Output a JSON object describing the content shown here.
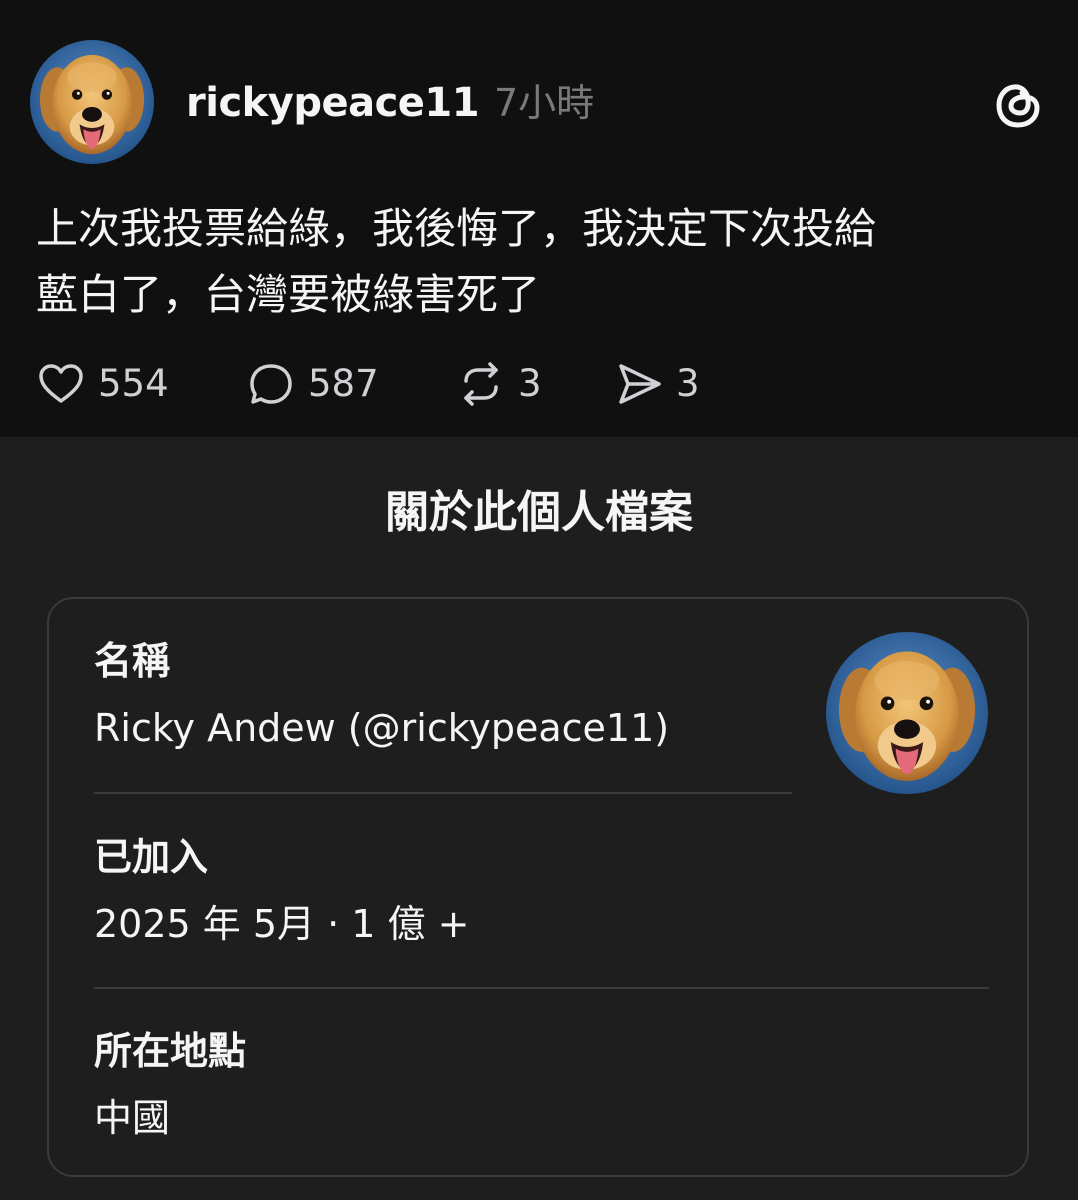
{
  "post": {
    "username": "rickypeace11",
    "time": "7小時",
    "logo_icon": "threads-logo-icon",
    "avatar_icon": "golden-retriever-avatar",
    "text_line1": "上次我投票給綠，我後悔了，我決定下次投給",
    "text_line2": "藍白了，台灣要被綠害死了",
    "actions": {
      "likes": "554",
      "replies": "587",
      "reposts": "3",
      "shares": "3"
    }
  },
  "profile_sheet": {
    "title": "關於此個人檔案",
    "name_label": "名稱",
    "name_value": "Ricky Andew (@rickypeace11)",
    "joined_label": "已加入",
    "joined_value": "2025 年 5月 · 1 億 +",
    "location_label": "所在地點",
    "location_value": "中國"
  },
  "colors": {
    "background": "#101010",
    "sheet_background": "#1e1e1e",
    "text_primary": "#f3f5f7",
    "text_secondary": "#7a7a7a",
    "border": "#3a3a3a",
    "avatar_bg": "#2f6aa8"
  }
}
